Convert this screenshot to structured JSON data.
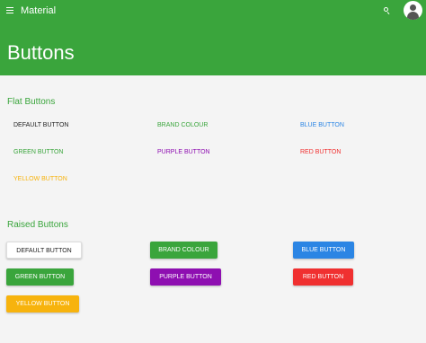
{
  "topbar": {
    "title": "Material",
    "menu_icon": "hamburger-menu-icon",
    "search_icon": "search-icon",
    "avatar_icon": "user-avatar-icon"
  },
  "page": {
    "title": "Buttons"
  },
  "colors": {
    "header": "#3aa53c",
    "brand": "#3aa53c",
    "blue": "#2b85e4",
    "green": "#3aa53c",
    "purple": "#8e0fb1",
    "red": "#f03030",
    "yellow": "#f7b30d",
    "default": "#222222"
  },
  "flat": {
    "title": "Flat Buttons",
    "buttons": {
      "default": "DEFAULT BUTTON",
      "brand": "BRAND COLOUR",
      "blue": "BLUE BUTTON",
      "green": "GREEN BUTTON",
      "purple": "PURPLE BUTTON",
      "red": "RED BUTTON",
      "yellow": "YELLOW BUTTON"
    }
  },
  "raised": {
    "title": "Raised Buttons",
    "buttons": {
      "default": "DEFAULT BUTTON",
      "brand": "BRAND COLOUR",
      "blue": "BLUE BUTTON",
      "green": "GREEN BUTTON",
      "purple": "PURPLE BUTTON",
      "red": "RED BUTTON",
      "yellow": "YELLOW BUTTON"
    }
  }
}
